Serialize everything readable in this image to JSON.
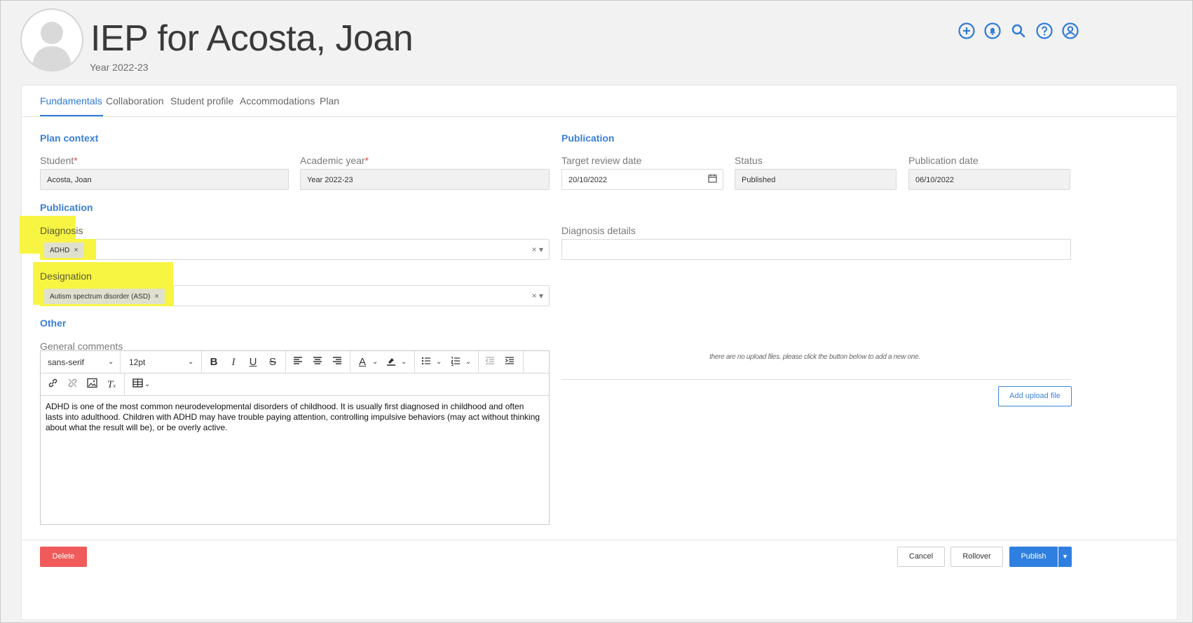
{
  "header": {
    "title": "IEP for Acosta, Joan",
    "subtitle": "Year 2022-23",
    "icons": [
      "add-icon",
      "bell-icon",
      "search-icon",
      "help-icon",
      "user-icon"
    ],
    "accent_color": "#2f7bd8"
  },
  "tabs": [
    {
      "label": "Fundamentals",
      "active": true
    },
    {
      "label": "Collaboration",
      "active": false
    },
    {
      "label": "Student profile",
      "active": false
    },
    {
      "label": "Accommodations",
      "active": false
    },
    {
      "label": "Plan",
      "active": false
    }
  ],
  "plan_context": {
    "heading": "Plan context",
    "student_label": "Student",
    "student_value": "Acosta, Joan",
    "year_label": "Academic year",
    "year_value": "Year 2022-23",
    "required_mark": "*"
  },
  "publication_top": {
    "heading": "Publication",
    "target_label": "Target review date",
    "target_value": "20/10/2022",
    "status_label": "Status",
    "status_value": "Published",
    "pubdate_label": "Publication date",
    "pubdate_value": "06/10/2022"
  },
  "publication_mid": {
    "heading": "Publication",
    "diagnosis_label": "Diagnosis",
    "diagnosis_tag": "ADHD",
    "diagnosis_details_label": "Diagnosis details",
    "designation_label": "Designation",
    "designation_tag": "Autism spectrum disorder (ASD)",
    "highlight_color": "#f7f542"
  },
  "other": {
    "heading": "Other",
    "comments_label": "General comments",
    "font_family": "sans-serif",
    "font_size": "12pt",
    "content": "ADHD is one of the most common neurodevelopmental disorders of childhood. It is usually first diagnosed in childhood and often lasts into adulthood. Children with ADHD may have trouble paying attention, controlling impulsive behaviors (may act without thinking about what the result will be), or be overly active."
  },
  "uploads": {
    "empty_note": "there are no upload files. please click the button below to add a new one.",
    "add_label": "Add upload file"
  },
  "footer": {
    "delete_label": "Delete",
    "cancel_label": "Cancel",
    "rollover_label": "Rollover",
    "publish_label": "Publish",
    "delete_color": "#f05a5a",
    "publish_color": "#2f7fe0"
  }
}
